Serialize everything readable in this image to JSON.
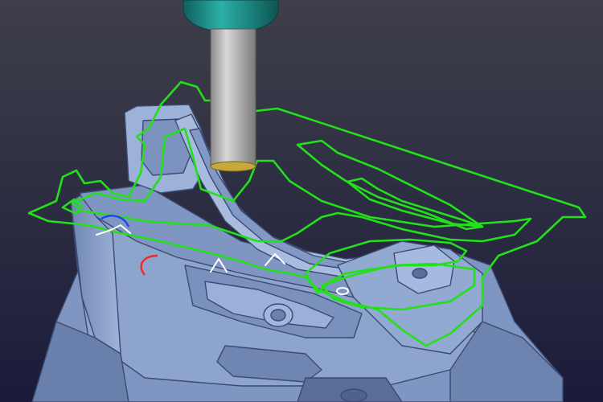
{
  "viewport": {
    "background_top": "#3f3f4a",
    "background_bottom": "#1a1b3a",
    "part_color": "#8fa6cf",
    "part_shadow": "#5f76a3",
    "part_highlight": "#b7c8e6",
    "edge_color": "#3b4a72",
    "toolpath_color": "#22e01a",
    "tool_holder_color": "#1f8f8a",
    "tool_shank_color": "#b8b8b8",
    "tool_tip_color": "#c8a83c",
    "lead_in_color": "#ff2020",
    "lead_out_color": "#2040ff",
    "link_color": "#ffffff"
  },
  "elements": {
    "machined_part": "cad-part",
    "cutting_tool": "endmill-tool",
    "toolpath": "contour-toolpath",
    "lead_in_arc": "lead-in-arc",
    "lead_out_arc": "lead-out-arc",
    "link_moves": "rapid-links"
  }
}
